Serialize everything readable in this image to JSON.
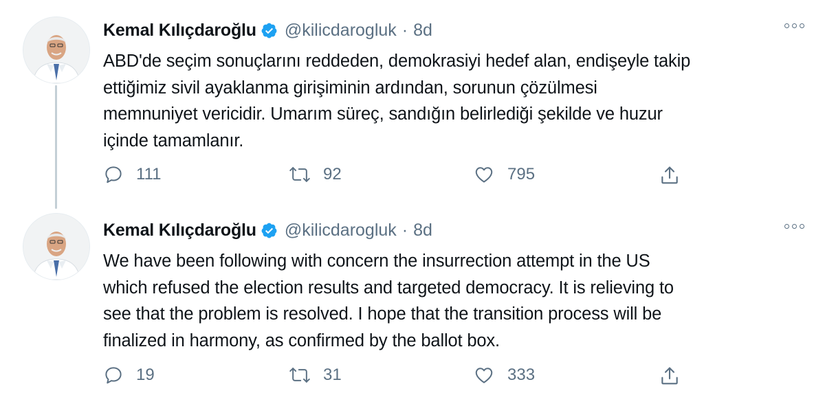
{
  "tweets": [
    {
      "author_name": "Kemal Kılıçdaroğlu",
      "handle": "@kilicdarogluk",
      "separator": "·",
      "time": "8d",
      "text_lines": [
        "ABD'de seçim sonuçlarını reddeden, demokrasiyi hedef alan, endişeyle takip",
        "ettiğimiz sivil ayaklanma girişiminin ardından, sorunun çözülmesi",
        "memnuniyet vericidir. Umarım süreç, sandığın belirlediği  şekilde ve huzur",
        "içinde tamamlanır."
      ],
      "replies": "111",
      "retweets": "92",
      "likes": "795"
    },
    {
      "author_name": "Kemal Kılıçdaroğlu",
      "handle": "@kilicdarogluk",
      "separator": "·",
      "time": "8d",
      "text_lines": [
        "We have been following with concern the insurrection attempt in the US",
        "which refused the election results and targeted democracy. It is relieving to",
        "see that the problem is resolved. I hope that the transition process will be",
        "finalized in harmony, as confirmed by the ballot box."
      ],
      "replies": "19",
      "retweets": "31",
      "likes": "333"
    }
  ],
  "colors": {
    "text": "#0f1419",
    "secondary": "#5b7083",
    "verified": "#1da1f2",
    "thread_line": "#c4cfd6"
  },
  "icons": [
    "verified-badge-icon",
    "more-icon",
    "reply-icon",
    "retweet-icon",
    "like-icon",
    "share-icon"
  ]
}
